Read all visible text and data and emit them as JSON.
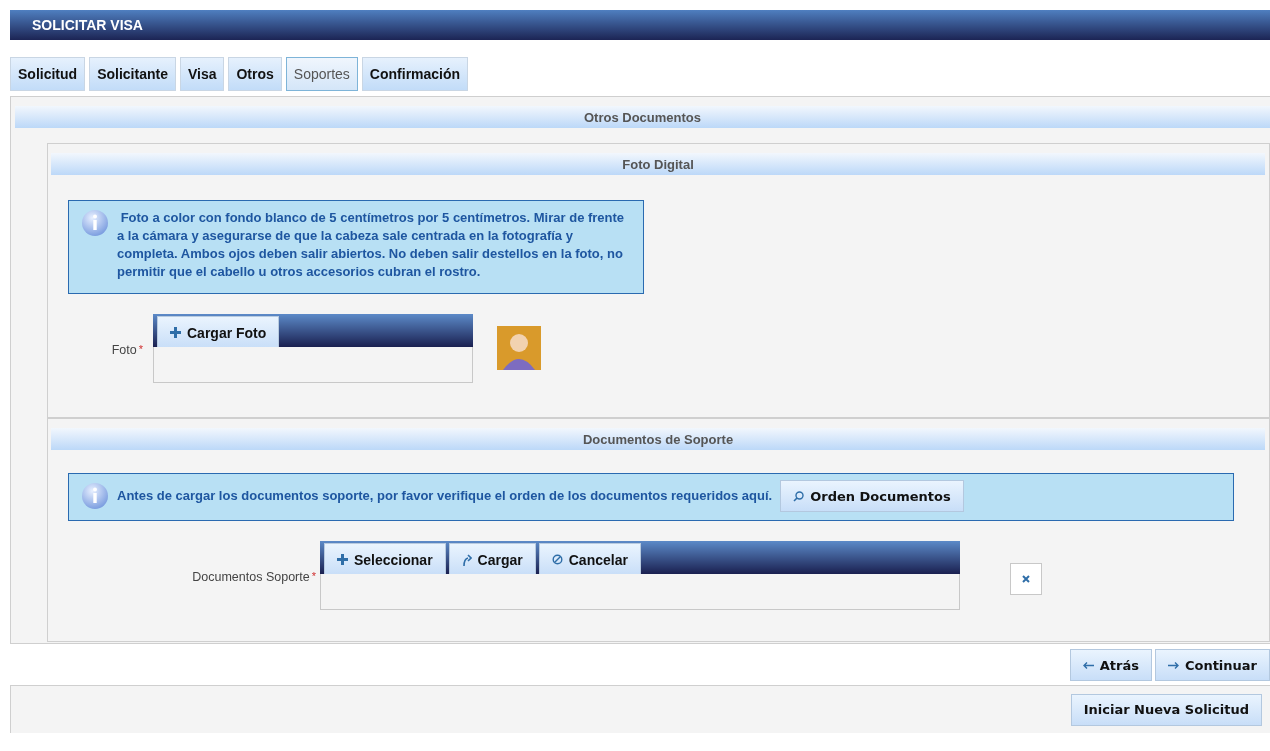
{
  "header": {
    "title": "SOLICITAR VISA"
  },
  "tabs": [
    {
      "label": "Solicitud",
      "selected": false
    },
    {
      "label": "Solicitante",
      "selected": false
    },
    {
      "label": "Visa",
      "selected": false
    },
    {
      "label": "Otros",
      "selected": false
    },
    {
      "label": "Soportes",
      "selected": true
    },
    {
      "label": "Confirmación",
      "selected": false
    }
  ],
  "panel": {
    "title": "Otros Documentos",
    "photo_section": {
      "title": "Foto Digital",
      "info": "Foto a color con fondo blanco de 5 centímetros por 5 centímetros. Mirar de frente a la cámara y asegurarse de que la cabeza sale centrada en la fotografía y completa. Ambos ojos deben salir abiertos. No deben salir destellos en la foto, no permitir que el cabello u otros accesorios cubran el rostro.",
      "field_label": "Foto",
      "required_mark": "*",
      "buttons": [
        {
          "label": "Cargar Foto",
          "kind": "add"
        }
      ]
    },
    "docs_section": {
      "title": "Documentos de Soporte",
      "info": "Antes de cargar los documentos soporte, por favor verifique el orden de los documentos requeridos aquí.",
      "info_button": "Orden Documentos",
      "field_label": "Documentos Soporte",
      "required_mark": "*",
      "buttons": [
        {
          "label": "Seleccionar",
          "kind": "add"
        },
        {
          "label": "Cargar",
          "kind": "upload"
        },
        {
          "label": "Cancelar",
          "kind": "cancel"
        }
      ]
    }
  },
  "nav_buttons": [
    {
      "label": "Atrás",
      "kind": "back"
    },
    {
      "label": "Continuar",
      "kind": "forward"
    }
  ],
  "footer_button": "Iniciar Nueva Solicitud"
}
